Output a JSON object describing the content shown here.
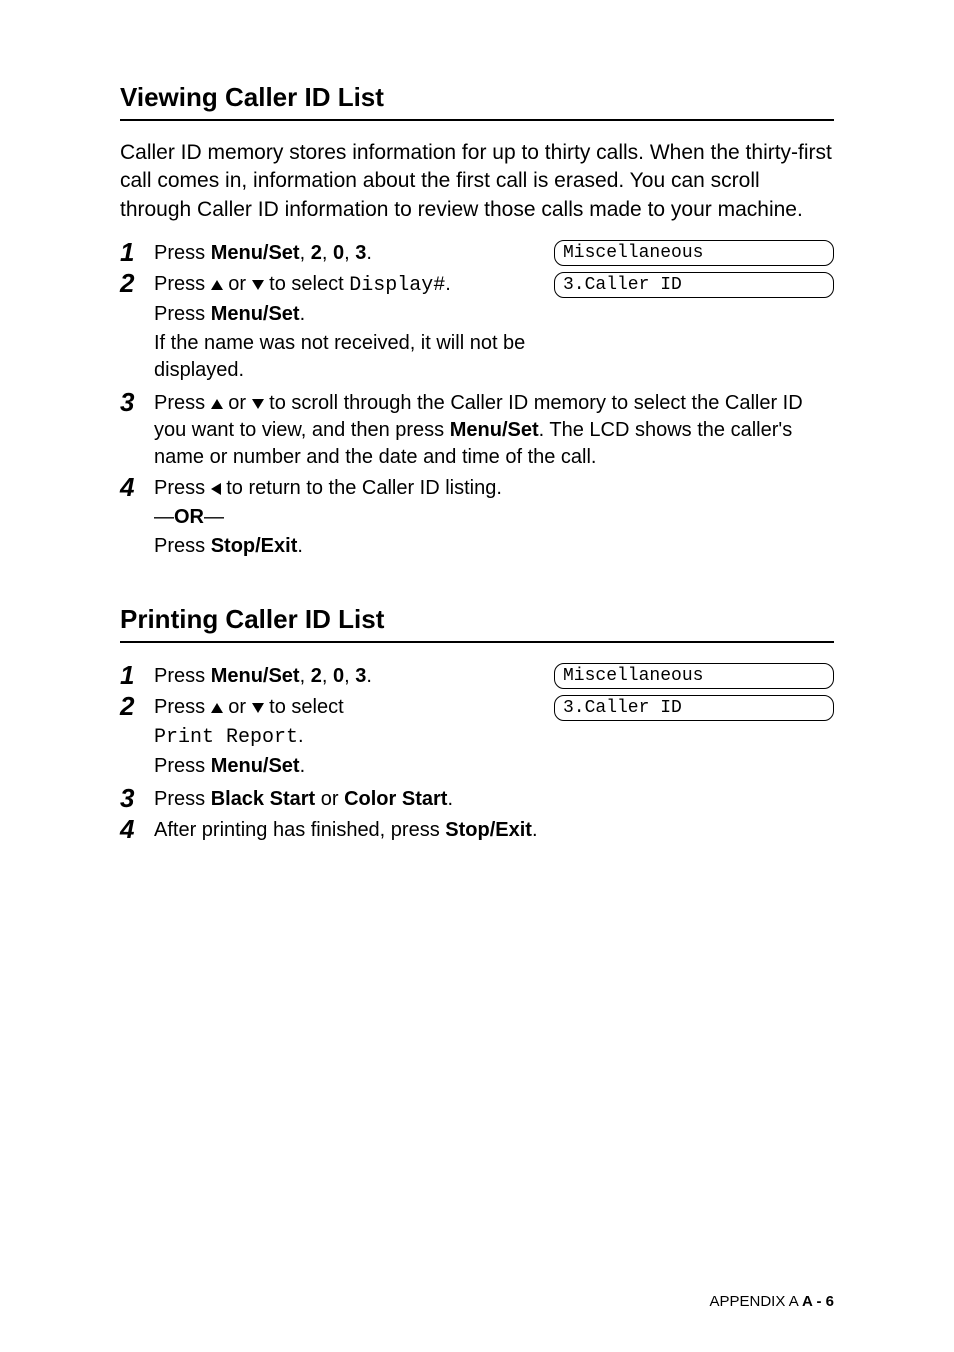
{
  "section1": {
    "title": "Viewing Caller ID List",
    "intro": "Caller ID memory stores information for up to thirty calls. When the thirty-first call comes in, information about the first call is erased. You can scroll through Caller ID information to review those calls made to your machine.",
    "lcd1": "Miscellaneous",
    "lcd2": "3.Caller ID",
    "step1": {
      "word_press": "Press ",
      "menu_set": "Menu/Set",
      "seq": ", ",
      "k2": "2",
      "k0": "0",
      "k3": "3",
      "end": "."
    },
    "step2": {
      "press": "Press ",
      "or": " or ",
      "to_select": " to select ",
      "display_hash": "Display#",
      "dot": ".",
      "line2_press": "Press ",
      "menu_set": "Menu/Set",
      "line2_end": ".",
      "note": "If the name was not received, it will not be displayed."
    },
    "step3": {
      "press": "Press ",
      "or": " or ",
      "rest_a": " to scroll through the Caller ID memory to select the Caller ID you want to view, and then press ",
      "menu_set": "Menu/Set",
      "rest_b": ". The LCD shows the caller's name or number and the date and time of the call."
    },
    "step4": {
      "press": "Press ",
      "rest": " to return to the Caller ID listing.",
      "dash": "—",
      "or_word": "OR",
      "line3_press": "Press ",
      "stop_exit": "Stop/Exit",
      "line3_end": "."
    }
  },
  "section2": {
    "title": "Printing Caller ID List",
    "lcd1": "Miscellaneous",
    "lcd2": "3.Caller ID",
    "step1": {
      "word_press": "Press ",
      "menu_set": "Menu/Set",
      "seq": ", ",
      "k2": "2",
      "k0": "0",
      "k3": "3",
      "end": "."
    },
    "step2": {
      "press": "Press ",
      "or": " or ",
      "to_select": " to select",
      "print_report": "Print Report",
      "dot": ".",
      "line2_press": "Press ",
      "menu_set": "Menu/Set",
      "line2_end": "."
    },
    "step3": {
      "press": "Press ",
      "black_start": "Black Start",
      "or_word": " or ",
      "color_start": "Color Start",
      "end": "."
    },
    "step4": {
      "a": "After printing has finished, press ",
      "stop_exit": "Stop/Exit",
      "end": "."
    }
  },
  "footer": {
    "appendix": "APPENDIX A   ",
    "page": "A - 6"
  }
}
